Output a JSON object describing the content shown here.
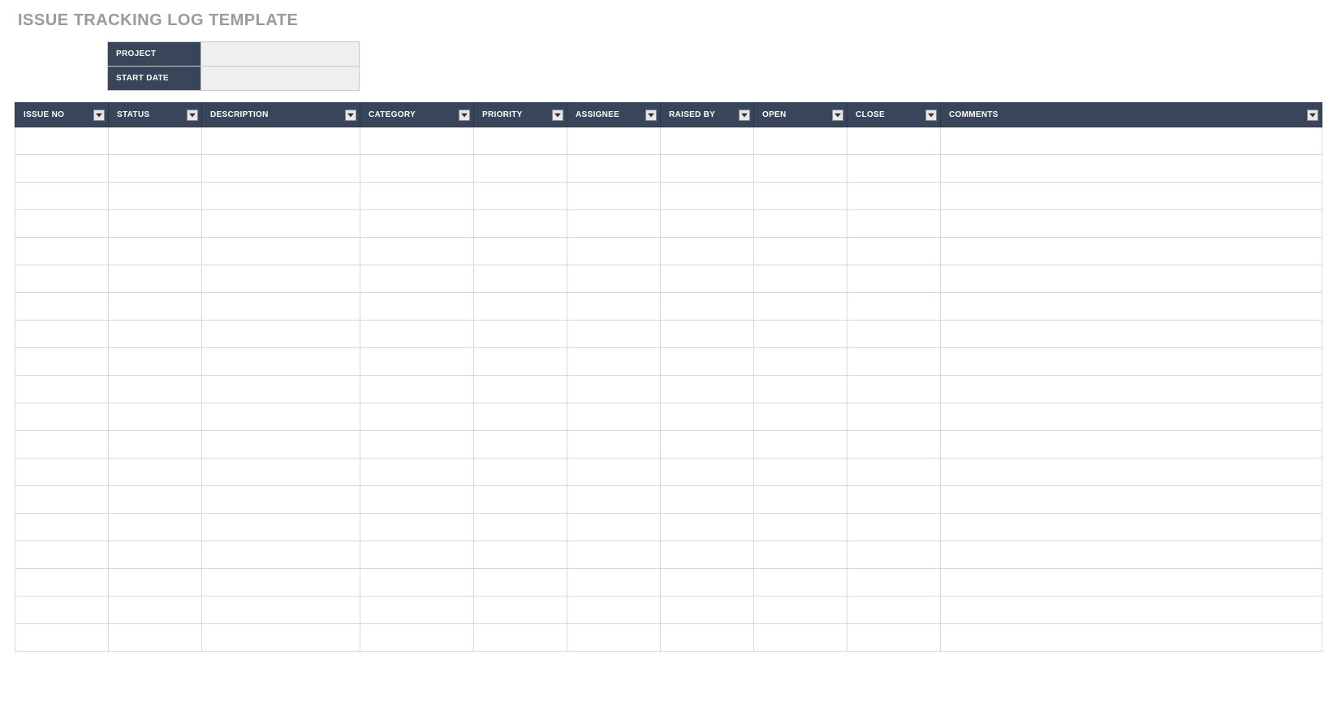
{
  "title": "ISSUE TRACKING LOG TEMPLATE",
  "meta": {
    "project_label": "PROJECT",
    "project_value": "",
    "start_date_label": "START DATE",
    "start_date_value": ""
  },
  "columns": [
    {
      "key": "issue_no",
      "label": "ISSUE NO"
    },
    {
      "key": "status",
      "label": "STATUS"
    },
    {
      "key": "description",
      "label": "DESCRIPTION"
    },
    {
      "key": "category",
      "label": "CATEGORY"
    },
    {
      "key": "priority",
      "label": "PRIORITY"
    },
    {
      "key": "assignee",
      "label": "ASSIGNEE"
    },
    {
      "key": "raised_by",
      "label": "RAISED BY"
    },
    {
      "key": "open",
      "label": "OPEN"
    },
    {
      "key": "close",
      "label": "CLOSE"
    },
    {
      "key": "comments",
      "label": "COMMENTS"
    }
  ],
  "rows": [
    {
      "issue_no": "",
      "status": "",
      "description": "",
      "category": "",
      "priority": "",
      "assignee": "",
      "raised_by": "",
      "open": "",
      "close": "",
      "comments": ""
    },
    {
      "issue_no": "",
      "status": "",
      "description": "",
      "category": "",
      "priority": "",
      "assignee": "",
      "raised_by": "",
      "open": "",
      "close": "",
      "comments": ""
    },
    {
      "issue_no": "",
      "status": "",
      "description": "",
      "category": "",
      "priority": "",
      "assignee": "",
      "raised_by": "",
      "open": "",
      "close": "",
      "comments": ""
    },
    {
      "issue_no": "",
      "status": "",
      "description": "",
      "category": "",
      "priority": "",
      "assignee": "",
      "raised_by": "",
      "open": "",
      "close": "",
      "comments": ""
    },
    {
      "issue_no": "",
      "status": "",
      "description": "",
      "category": "",
      "priority": "",
      "assignee": "",
      "raised_by": "",
      "open": "",
      "close": "",
      "comments": ""
    },
    {
      "issue_no": "",
      "status": "",
      "description": "",
      "category": "",
      "priority": "",
      "assignee": "",
      "raised_by": "",
      "open": "",
      "close": "",
      "comments": ""
    },
    {
      "issue_no": "",
      "status": "",
      "description": "",
      "category": "",
      "priority": "",
      "assignee": "",
      "raised_by": "",
      "open": "",
      "close": "",
      "comments": ""
    },
    {
      "issue_no": "",
      "status": "",
      "description": "",
      "category": "",
      "priority": "",
      "assignee": "",
      "raised_by": "",
      "open": "",
      "close": "",
      "comments": ""
    },
    {
      "issue_no": "",
      "status": "",
      "description": "",
      "category": "",
      "priority": "",
      "assignee": "",
      "raised_by": "",
      "open": "",
      "close": "",
      "comments": ""
    },
    {
      "issue_no": "",
      "status": "",
      "description": "",
      "category": "",
      "priority": "",
      "assignee": "",
      "raised_by": "",
      "open": "",
      "close": "",
      "comments": ""
    },
    {
      "issue_no": "",
      "status": "",
      "description": "",
      "category": "",
      "priority": "",
      "assignee": "",
      "raised_by": "",
      "open": "",
      "close": "",
      "comments": ""
    },
    {
      "issue_no": "",
      "status": "",
      "description": "",
      "category": "",
      "priority": "",
      "assignee": "",
      "raised_by": "",
      "open": "",
      "close": "",
      "comments": ""
    },
    {
      "issue_no": "",
      "status": "",
      "description": "",
      "category": "",
      "priority": "",
      "assignee": "",
      "raised_by": "",
      "open": "",
      "close": "",
      "comments": ""
    },
    {
      "issue_no": "",
      "status": "",
      "description": "",
      "category": "",
      "priority": "",
      "assignee": "",
      "raised_by": "",
      "open": "",
      "close": "",
      "comments": ""
    },
    {
      "issue_no": "",
      "status": "",
      "description": "",
      "category": "",
      "priority": "",
      "assignee": "",
      "raised_by": "",
      "open": "",
      "close": "",
      "comments": ""
    },
    {
      "issue_no": "",
      "status": "",
      "description": "",
      "category": "",
      "priority": "",
      "assignee": "",
      "raised_by": "",
      "open": "",
      "close": "",
      "comments": ""
    },
    {
      "issue_no": "",
      "status": "",
      "description": "",
      "category": "",
      "priority": "",
      "assignee": "",
      "raised_by": "",
      "open": "",
      "close": "",
      "comments": ""
    },
    {
      "issue_no": "",
      "status": "",
      "description": "",
      "category": "",
      "priority": "",
      "assignee": "",
      "raised_by": "",
      "open": "",
      "close": "",
      "comments": ""
    },
    {
      "issue_no": "",
      "status": "",
      "description": "",
      "category": "",
      "priority": "",
      "assignee": "",
      "raised_by": "",
      "open": "",
      "close": "",
      "comments": ""
    }
  ]
}
